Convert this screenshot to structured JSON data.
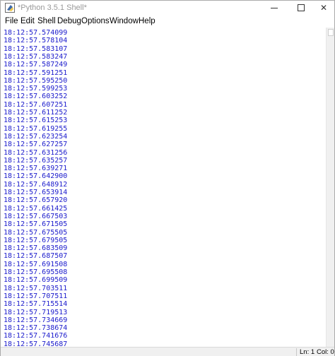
{
  "window": {
    "title": "*Python 3.5.1 Shell*",
    "controls": {
      "minimize": "—",
      "maximize": "□",
      "close": "✕"
    }
  },
  "menu": [
    "File",
    "Edit",
    "Shell",
    "Debug",
    "Options",
    "Window",
    "Help"
  ],
  "output_lines": [
    "18:12:57.574099",
    "18:12:57.578104",
    "18:12:57.583107",
    "18:12:57.583247",
    "18:12:57.587249",
    "18:12:57.591251",
    "18:12:57.595250",
    "18:12:57.599253",
    "18:12:57.603252",
    "18:12:57.607251",
    "18:12:57.611252",
    "18:12:57.615253",
    "18:12:57.619255",
    "18:12:57.623254",
    "18:12:57.627257",
    "18:12:57.631256",
    "18:12:57.635257",
    "18:12:57.639271",
    "18:12:57.642900",
    "18:12:57.648912",
    "18:12:57.653914",
    "18:12:57.657920",
    "18:12:57.661425",
    "18:12:57.667503",
    "18:12:57.671505",
    "18:12:57.675505",
    "18:12:57.679505",
    "18:12:57.683509",
    "18:12:57.687507",
    "18:12:57.691508",
    "18:12:57.695508",
    "18:12:57.699509",
    "18:12:57.703511",
    "18:12:57.707511",
    "18:12:57.715514",
    "18:12:57.719513",
    "18:12:57.734669",
    "18:12:57.738674",
    "18:12:57.741676",
    "18:12:57.745687"
  ],
  "status": {
    "line": "Ln: 1",
    "col": "Col: 0"
  },
  "colors": {
    "output_text": "#1a1acc",
    "title_text": "#999999"
  },
  "icons": {
    "app": "python-idle-icon"
  }
}
